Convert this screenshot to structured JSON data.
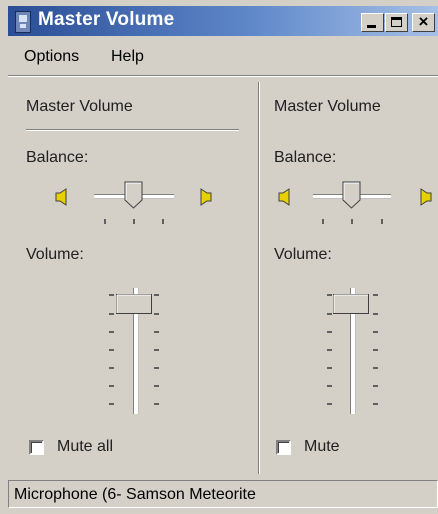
{
  "window": {
    "title": "Master Volume"
  },
  "menu": {
    "items": [
      "Options",
      "Help"
    ]
  },
  "channels": [
    {
      "name": "Master Volume",
      "balance_label": "Balance:",
      "volume_label": "Volume:",
      "mute_label": "Mute all",
      "mute_checked": false,
      "balance_value": 0.5,
      "volume_value": 0.95
    },
    {
      "name": "Master Volume",
      "balance_label": "Balance:",
      "volume_label": "Volume:",
      "mute_label": "Mute",
      "mute_checked": false,
      "balance_value": 0.5,
      "volume_value": 0.95
    }
  ],
  "status": {
    "text": "Microphone (6- Samson Meteorite"
  },
  "icons": {
    "app": "mixer-icon",
    "balance_left": "speaker-left-icon",
    "balance_right": "speaker-right-icon",
    "minimize": "minimize-icon",
    "maximize": "maximize-icon",
    "close": "close-icon"
  },
  "colors": {
    "titlebar": "#2a4d95",
    "face": "#d4d0c8",
    "speaker": "#e8d000"
  }
}
